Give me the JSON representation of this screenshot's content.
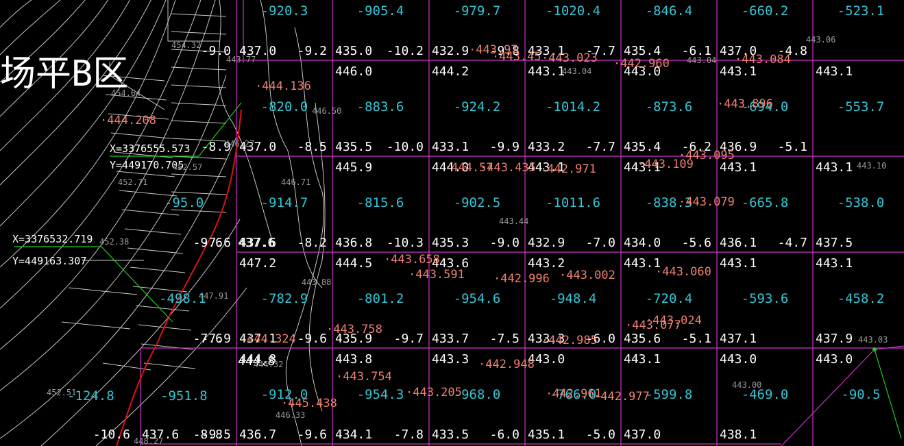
{
  "title_text": "场平B区",
  "coord_labels": [
    {
      "x_label": "X=3376555.573",
      "y_label": "Y=449170.705"
    },
    {
      "x_label": "X=3376532.719",
      "y_label": "Y=449163.307"
    }
  ],
  "grid_cells": [
    [
      {
        "volume": "-920.3",
        "cut": "-9.0",
        "design": "437.0",
        "existing": ""
      },
      {
        "volume": "-905.4",
        "cut": "-9.2",
        "design": "435.0",
        "existing": "446.0"
      },
      {
        "volume": "-979.7",
        "cut": "-10.2",
        "design": "432.9",
        "existing": "444.2"
      },
      {
        "volume": "-1020.4",
        "cut": "-9.8",
        "design": "433.1",
        "existing": "443.1"
      },
      {
        "volume": "-846.4",
        "cut": "-7.7",
        "design": "435.4",
        "existing": "443.0"
      },
      {
        "volume": "-660.2",
        "cut": "-6.1",
        "design": "437.0",
        "existing": "443.1"
      },
      {
        "volume": "-523.1",
        "cut": "-4.8",
        "design": "",
        "existing": "443.1"
      }
    ],
    [
      {
        "volume": "-820.0",
        "cut": "-8.9",
        "design": "437.0",
        "existing": ""
      },
      {
        "volume": "-883.6",
        "cut": "-8.5",
        "design": "435.5",
        "existing": "445.9"
      },
      {
        "volume": "-924.2",
        "cut": "-10.0",
        "design": "433.1",
        "existing": "444.0"
      },
      {
        "volume": "-1014.2",
        "cut": "-9.9",
        "design": "433.2",
        "existing": "443.1"
      },
      {
        "volume": "-873.6",
        "cut": "-7.7",
        "design": "435.4",
        "existing": "443.1"
      },
      {
        "volume": "-694.0",
        "cut": "-6.2",
        "design": "436.9",
        "existing": "443.1"
      },
      {
        "volume": "-553.7",
        "cut": "-5.1",
        "design": "",
        "existing": "443.1"
      }
    ],
    [
      {
        "volume": "-914.7",
        "cut": "-7.6",
        "design": "437.6",
        "existing": "447.2"
      },
      {
        "volume": "-815.6",
        "cut": "-8.2",
        "design": "436.8",
        "existing": "444.5"
      },
      {
        "volume": "-902.5",
        "cut": "-10.3",
        "design": "435.3",
        "existing": "443.6"
      },
      {
        "volume": "-1011.6",
        "cut": "-9.0",
        "design": "432.9",
        "existing": "443.2"
      },
      {
        "volume": "-838.3",
        "cut": "-7.0",
        "design": "434.0",
        "existing": "443.1"
      },
      {
        "volume": "-665.8",
        "cut": "-5.6",
        "design": "436.1",
        "existing": "443.1"
      },
      {
        "volume": "-538.0",
        "cut": "-4.7",
        "design": "437.5",
        "existing": "443.1"
      }
    ],
    [
      {
        "volume": "-782.9",
        "cut": "-7.9",
        "design": "437.1",
        "existing": "444.8"
      },
      {
        "volume": "-801.2",
        "cut": "-9.6",
        "design": "435.9",
        "existing": "443.8"
      },
      {
        "volume": "-954.6",
        "cut": "-9.7",
        "design": "433.7",
        "existing": "443.3"
      },
      {
        "volume": "-948.4",
        "cut": "-7.5",
        "design": "433.3",
        "existing": "443.0"
      },
      {
        "volume": "-720.4",
        "cut": "-6.0",
        "design": "435.6",
        "existing": "443.1"
      },
      {
        "volume": "-593.6",
        "cut": "-5.1",
        "design": "437.1",
        "existing": "443.0"
      },
      {
        "volume": "-458.2",
        "cut": "",
        "design": "437.9",
        "existing": "443.0"
      }
    ],
    [
      {
        "volume": "-912.0",
        "cut": "-9.5",
        "design": "436.7",
        "existing": ""
      },
      {
        "volume": "-954.3",
        "cut": "-9.6",
        "design": "434.1",
        "existing": ""
      },
      {
        "volume": "-968.0",
        "cut": "-7.8",
        "design": "433.5",
        "existing": ""
      },
      {
        "volume": "-766.0",
        "cut": "-6.0",
        "design": "435.1",
        "existing": ""
      },
      {
        "volume": "-599.8",
        "cut": "-5.0",
        "design": "437.0",
        "existing": ""
      },
      {
        "volume": "-469.0",
        "cut": "",
        "design": "438.1",
        "existing": ""
      },
      {
        "volume": "-90.5",
        "cut": "",
        "design": "",
        "existing": ""
      }
    ]
  ],
  "left_partial_values": {
    "volumes": [
      "-95.0",
      "-498.1",
      "-951.8",
      "-124.8"
    ],
    "cuts": [
      "-9.6",
      "-7.6",
      "-8.8",
      "-10.6"
    ],
    "designs": [
      "437.6",
      "437.6"
    ],
    "existing": [
      "444.8"
    ]
  },
  "survey_points": [
    {
      "label": "443.97"
    },
    {
      "label": "443.45"
    },
    {
      "label": "443.023"
    },
    {
      "label": "442.960"
    },
    {
      "label": "443.084"
    },
    {
      "label": "444.136"
    },
    {
      "label": "443.896"
    },
    {
      "label": "444.208"
    },
    {
      "label": "444.57"
    },
    {
      "label": "443.435"
    },
    {
      "label": "442.971"
    },
    {
      "label": "443.109"
    },
    {
      "label": "443.095"
    },
    {
      "label": "443.079"
    },
    {
      "label": "443.658"
    },
    {
      "label": "443.591"
    },
    {
      "label": "442.996"
    },
    {
      "label": "443.002"
    },
    {
      "label": "443.060"
    },
    {
      "label": "443.024"
    },
    {
      "label": "443.077"
    },
    {
      "label": "443.758"
    },
    {
      "label": "442.985"
    },
    {
      "label": "444.324"
    },
    {
      "label": "442.948"
    },
    {
      "label": "443.754"
    },
    {
      "label": "443.205"
    },
    {
      "label": "445.438"
    },
    {
      "label": "442.961"
    },
    {
      "label": "442.977"
    }
  ],
  "contour_labels": [
    "454.32",
    "443.77",
    "454.64",
    "446.50",
    "446.27",
    "452.57",
    "452.71",
    "446.71",
    "452.38",
    "443.44",
    "443.88",
    "447.91",
    "443.06",
    "443.04",
    "443.04",
    "443.10",
    "443.03",
    "443.00",
    "452.51",
    "446.33",
    "444.32",
    "448.27"
  ],
  "colors": {
    "background": "#000000",
    "grid": "#cc33cc",
    "volume_text": "#33c6d6",
    "value_text": "#ffffff",
    "survey_text": "#f08070",
    "contour": "#c8c8c8",
    "boundary": "#e01010",
    "leader": "#22cc22",
    "contour_label": "#9a9a9a"
  }
}
